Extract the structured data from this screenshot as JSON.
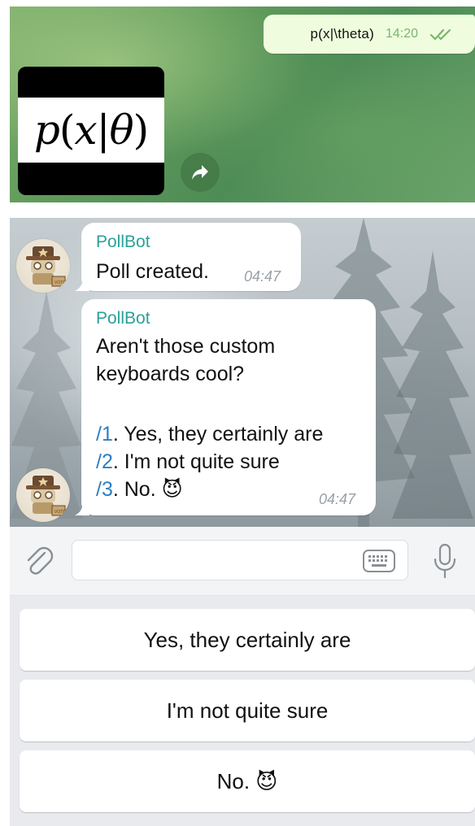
{
  "top_chat": {
    "outgoing_message": {
      "text": "p(x|\\theta)",
      "time": "14:20",
      "status": "read"
    },
    "image_message": {
      "latex_p": "p",
      "latex_open": "(",
      "latex_x": "x",
      "latex_bar": "|",
      "latex_theta": "θ",
      "latex_close": ")"
    }
  },
  "bot_chat": {
    "messages": [
      {
        "sender": "PollBot",
        "text": "Poll created.",
        "time": "04:47"
      },
      {
        "sender": "PollBot",
        "lines": [
          "Aren't those custom",
          "keyboards cool?"
        ],
        "options": [
          {
            "command": "/1",
            "text": ". Yes, they certainly are"
          },
          {
            "command": "/2",
            "text": ". I'm not quite sure"
          },
          {
            "command": "/3",
            "text": ". No. 😈"
          }
        ],
        "time": "04:47"
      }
    ]
  },
  "input_bar": {
    "placeholder": ""
  },
  "keyboard": {
    "buttons": [
      "Yes, they certainly are",
      "I'm not quite sure",
      "No. 😈"
    ]
  },
  "colors": {
    "sender": "#2aa198",
    "command_link": "#2f7fc1",
    "outgoing_bubble": "#effdde",
    "read_check": "#7bb56e"
  }
}
